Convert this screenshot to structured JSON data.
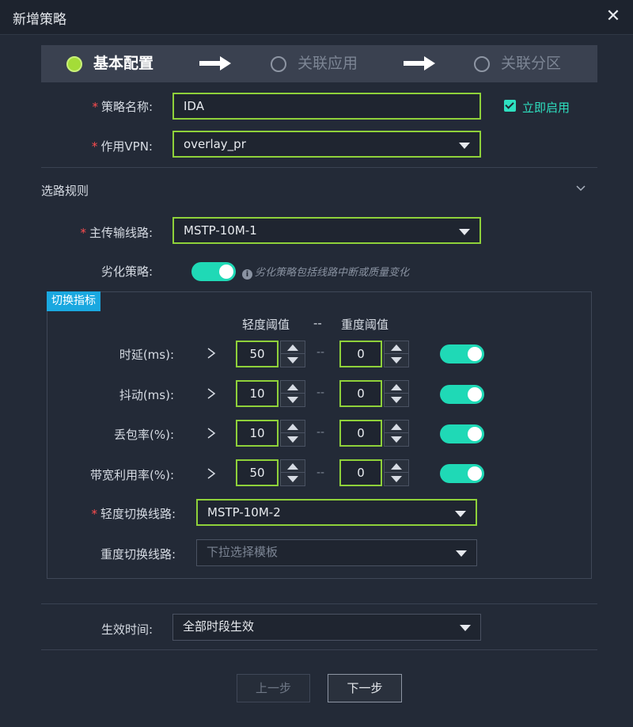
{
  "dialog": {
    "title": "新增策略"
  },
  "steps": [
    {
      "label": "基本配置",
      "active": true
    },
    {
      "label": "关联应用",
      "active": false
    },
    {
      "label": "关联分区",
      "active": false
    }
  ],
  "form": {
    "policy_name_label": "策略名称:",
    "policy_name_value": "IDA",
    "enable_now_label": "立即启用",
    "enable_now_checked": true,
    "vpn_label": "作用VPN:",
    "vpn_value": "overlay_pr"
  },
  "route_rules": {
    "section_title": "选路规则",
    "primary_link_label": "主传输线路:",
    "primary_link_value": "MSTP-10M-1",
    "degrade_label": "劣化策略:",
    "degrade_enabled": true,
    "degrade_hint": "劣化策略包括线路中断或质量变化"
  },
  "switch_metrics": {
    "tag": "切换指标",
    "col_light": "轻度阈值",
    "col_sep": "--",
    "col_heavy": "重度阈值",
    "rows": [
      {
        "label": "时延(ms):",
        "op": ">",
        "light": "50",
        "heavy": "0",
        "enabled": true
      },
      {
        "label": "抖动(ms):",
        "op": ">",
        "light": "10",
        "heavy": "0",
        "enabled": true
      },
      {
        "label": "丢包率(%):",
        "op": ">",
        "light": "10",
        "heavy": "0",
        "enabled": true
      },
      {
        "label": "带宽利用率(%):",
        "op": ">",
        "light": "50",
        "heavy": "0",
        "enabled": true
      }
    ],
    "row_sep": "--",
    "light_switch_label": "轻度切换线路:",
    "light_switch_value": "MSTP-10M-2",
    "heavy_switch_label": "重度切换线路:",
    "heavy_switch_placeholder": "下拉选择模板"
  },
  "effective_time": {
    "label": "生效时间:",
    "value": "全部时段生效"
  },
  "buttons": {
    "prev": "上一步",
    "next": "下一步"
  },
  "colors": {
    "accent_green": "#8fd13a",
    "toggle_teal": "#1fd9b6",
    "tag_blue": "#1aa8e0",
    "required_red": "#ff4d4f"
  }
}
